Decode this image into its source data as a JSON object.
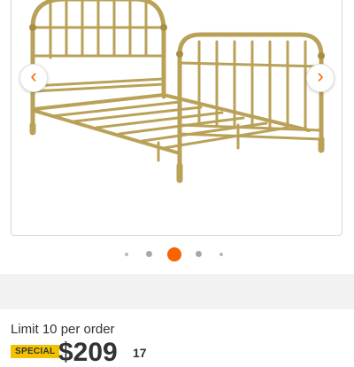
{
  "product": {
    "image_alt": "Gold metal spindle bed frame",
    "limit_text": "Limit 10 per order",
    "special_badge": "SPECIAL",
    "price_dollars": "$209",
    "price_cents": "17"
  },
  "carousel": {
    "prev_icon": "chevron-left-icon",
    "next_icon": "chevron-right-icon",
    "prev_glyph": "‹",
    "next_glyph": "›",
    "dot_count": 5,
    "active_index": 2
  },
  "colors": {
    "accent": "#f96302",
    "badge": "#f2c200",
    "frame_gold": "#b8a05a"
  }
}
